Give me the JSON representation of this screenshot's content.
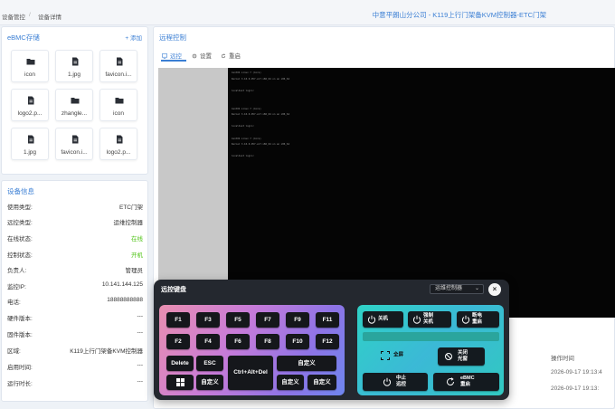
{
  "breadcrumb": {
    "level1": "设备管控",
    "sep": "/",
    "level2": "设备详情"
  },
  "page_title": "中意平朗山分公司 - K119上行门架备KVM控制器-ETC门架",
  "storage": {
    "title": "eBMC存储",
    "add_label": "+ 添加",
    "files": [
      {
        "name": "icon",
        "icon": "folder-icon"
      },
      {
        "name": "1.jpg",
        "icon": "file-icon"
      },
      {
        "name": "favicon.i...",
        "icon": "file-icon"
      },
      {
        "name": "logo2.p...",
        "icon": "file-icon"
      },
      {
        "name": "zhangle...",
        "icon": "folder-icon"
      },
      {
        "name": "icon",
        "icon": "folder-icon"
      },
      {
        "name": "1.jpg",
        "icon": "file-icon"
      },
      {
        "name": "favicon.i...",
        "icon": "file-icon"
      },
      {
        "name": "logo2.p...",
        "icon": "file-icon"
      }
    ]
  },
  "device_info": {
    "title": "设备信息",
    "rows": [
      {
        "label": "使用类型:",
        "value": "ETC门架"
      },
      {
        "label": "远控类型:",
        "value": "运维控制器"
      },
      {
        "label": "在线状态:",
        "value": "在线",
        "status": "online"
      },
      {
        "label": "控制状态:",
        "value": "开机",
        "status": "online"
      },
      {
        "label": "负责人:",
        "value": "管理员"
      },
      {
        "label": "监控IP:",
        "value": "10.141.144.125"
      },
      {
        "label": "电话:",
        "value": "18888888888"
      },
      {
        "label": "硬件版本:",
        "value": "---"
      },
      {
        "label": "固件版本:",
        "value": "---"
      },
      {
        "label": "区域:",
        "value": "K119上行门架备KVM控制器"
      },
      {
        "label": "启用时间:",
        "value": "---"
      },
      {
        "label": "运行时长:",
        "value": "---"
      }
    ]
  },
  "remote": {
    "title": "远程控制",
    "tabs": [
      {
        "label": "远控",
        "icon": "monitor-icon",
        "active": true
      },
      {
        "label": "设置",
        "icon": "gear-icon",
        "active": false
      },
      {
        "label": "重启",
        "icon": "refresh-icon",
        "active": false
      }
    ]
  },
  "terminal_lines": [
    "CentOS Linux 7 (Core)",
    "Kernel 3.10.0-957.el7.x86_64 on an x86_64",
    "",
    "localhost login:",
    "",
    "",
    "CentOS Linux 7 (Core)",
    "Kernel 3.10.0-957.el7.x86_64 on an x86_64",
    "",
    "localhost login:",
    "",
    "CentOS Linux 7 (Core)",
    "Kernel 3.10.0-957.el7.x86_64 on an x86_64",
    "",
    "localhost login:"
  ],
  "log": {
    "header": "操作时间",
    "times": [
      "2026-09-17 19:13:4",
      "2026-09-17 19:13:"
    ]
  },
  "keyboard": {
    "title": "远控键盘",
    "mode_select": "运维控制器",
    "close_label": "×",
    "fkeys_row1": [
      "F1",
      "F3",
      "F5",
      "F7",
      "F9",
      "F11"
    ],
    "fkeys_row2": [
      "F2",
      "F4",
      "F6",
      "F8",
      "F10",
      "F12"
    ],
    "delete_label": "Delete",
    "esc_label": "ESC",
    "cad_label": "Ctrl+Alt+Del",
    "custom_label": "自定义",
    "controls": {
      "shutdown": "关机",
      "force_shutdown_l1": "强制",
      "force_shutdown_l2": "关机",
      "power_reset_l1": "断电",
      "power_reset_l2": "重启",
      "fullscreen": "全屏",
      "close_light_l1": "关闭",
      "close_light_l2": "光窗",
      "stop_remote_l1": "中止",
      "stop_remote_l2": "远控",
      "ebmc_reboot_l1": "eBMC",
      "ebmc_reboot_l2": "重启"
    }
  },
  "colors": {
    "accent": "#3b7fd4",
    "online": "#52c41a",
    "keyboard_bg": "#24282f",
    "terminal_bg": "#050505"
  }
}
